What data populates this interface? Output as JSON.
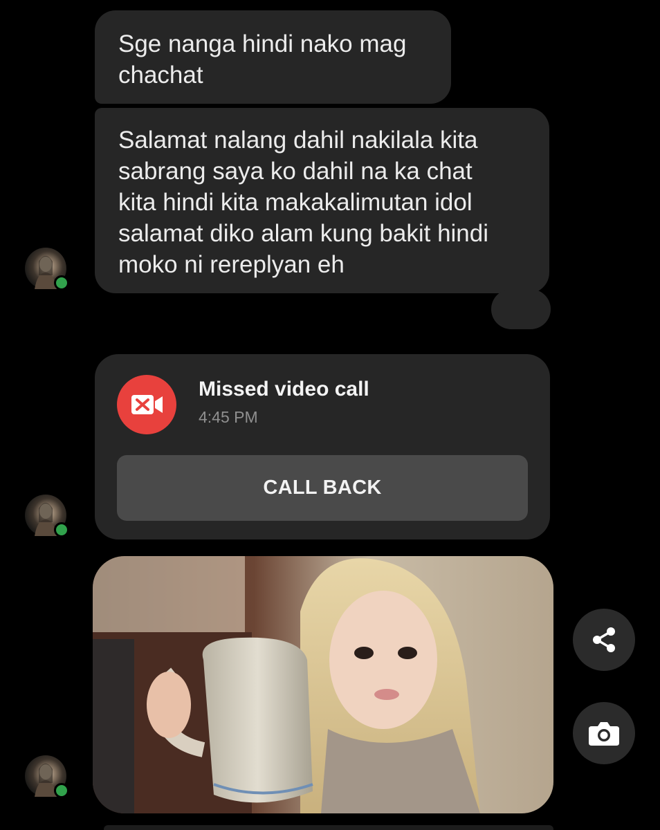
{
  "messages": [
    {
      "lines": [
        "Sge nanga hindi nako mag",
        "chachat"
      ]
    },
    {
      "lines": [
        "Salamat nalang dahil nakilala kita",
        "sabrang saya ko dahil na ka chat",
        "kita hindi kita makakalimutan idol",
        "salamat diko alam kung bakit hindi",
        "moko ni rereplyan eh"
      ]
    }
  ],
  "missed_call": {
    "title": "Missed video call",
    "time": "4:45 PM",
    "callback_label": "CALL BACK",
    "icon": "missed-video-call-icon",
    "icon_color": "#e8413d"
  },
  "photo_message": {
    "alt": "photo"
  },
  "actions": {
    "share_icon": "share-icon",
    "camera_icon": "camera-icon"
  },
  "colors": {
    "background": "#000000",
    "bubble": "#262626",
    "online": "#31a24c",
    "button": "#4a4a4a"
  }
}
